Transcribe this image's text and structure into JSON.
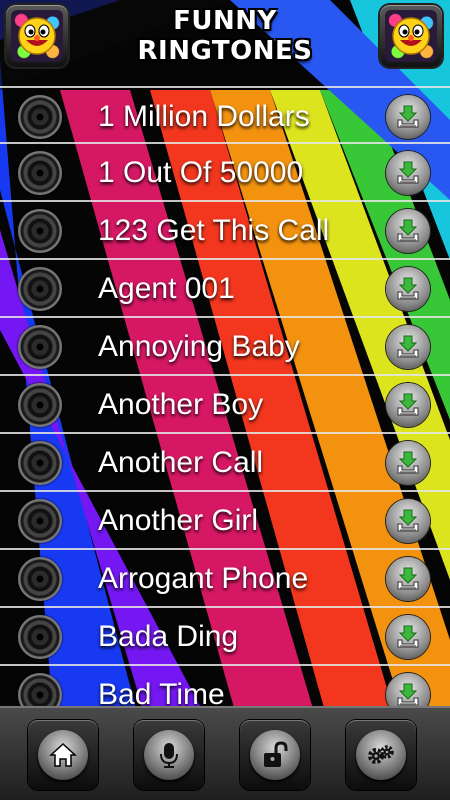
{
  "header": {
    "title_line1": "FUNNY",
    "title_line2": "RINGTONES",
    "left_icon": "smiley-face-icon",
    "right_icon": "smiley-face-icon"
  },
  "ringtones": [
    {
      "name": "1 Million Dollars"
    },
    {
      "name": "1 Out Of 50000"
    },
    {
      "name": "123 Get This Call"
    },
    {
      "name": "Agent 001"
    },
    {
      "name": "Annoying Baby"
    },
    {
      "name": "Another Boy"
    },
    {
      "name": "Another Call"
    },
    {
      "name": "Another Girl"
    },
    {
      "name": "Arrogant Phone"
    },
    {
      "name": "Bada Ding"
    },
    {
      "name": "Bad Time"
    }
  ],
  "row_icons": {
    "play": "speaker-play-icon",
    "download": "download-icon"
  },
  "toolbar": {
    "items": [
      {
        "icon": "home-icon"
      },
      {
        "icon": "microphone-icon"
      },
      {
        "icon": "unlock-icon"
      },
      {
        "icon": "settings-gears-icon"
      }
    ]
  },
  "colors": {
    "text": "#ffffff",
    "download_arrow": "#3cb93c",
    "background": "#000000"
  }
}
